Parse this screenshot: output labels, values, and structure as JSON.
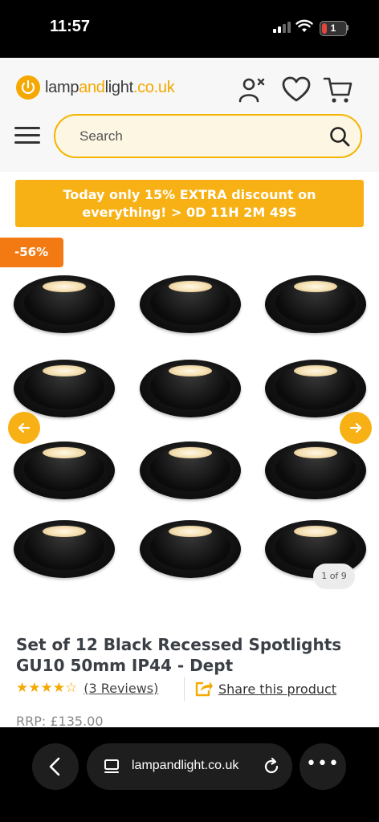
{
  "status_bar": {
    "time": "11:57",
    "battery": "1"
  },
  "header": {
    "logo": {
      "part1": "lamp",
      "part2": "and",
      "part3": "light",
      "part4": ".co.uk"
    },
    "search": {
      "placeholder": "Search"
    },
    "icons": [
      "account-icon",
      "wishlist-heart-icon",
      "cart-icon",
      "menu-icon",
      "search-icon"
    ]
  },
  "promo": {
    "text": "Today only 15% EXTRA discount on everything! > 0D 11H 2M 49S"
  },
  "product": {
    "discount_badge": "-56%",
    "gallery_counter": "1 of 9",
    "title": "Set of 12 Black Recessed Spotlights GU10 50mm IP44 - Dept",
    "stars": "★★★★☆",
    "rating": 4.5,
    "reviews": "(3 Reviews)",
    "share": "Share this product",
    "rrp": "RRP: £135.00"
  },
  "browser": {
    "url": "lampandlight.co.uk"
  },
  "colors": {
    "accent": "#f7b114",
    "badge": "#f37a12",
    "text": "#3a3f45"
  }
}
